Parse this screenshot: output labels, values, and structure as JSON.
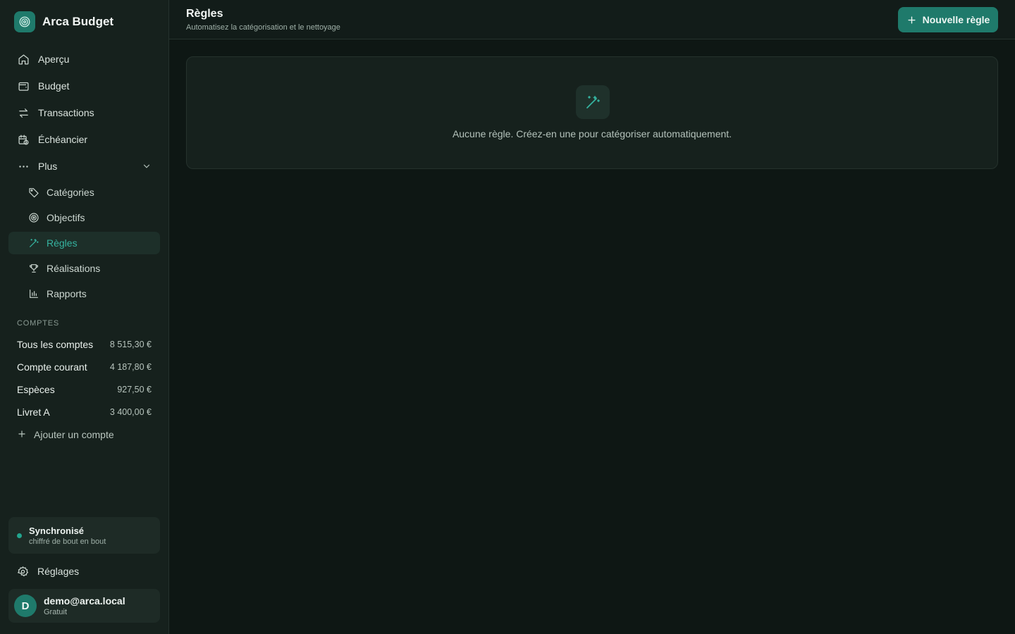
{
  "app": {
    "name": "Arca Budget",
    "logo_icon": "fingerprint-icon"
  },
  "nav": {
    "items": [
      {
        "label": "Aperçu",
        "icon": "home-icon"
      },
      {
        "label": "Budget",
        "icon": "wallet-icon"
      },
      {
        "label": "Transactions",
        "icon": "arrows-exchange-icon"
      },
      {
        "label": "Échéancier",
        "icon": "calendar-clock-icon"
      },
      {
        "label": "Plus",
        "icon": "more-dots-icon"
      }
    ],
    "sub_items": [
      {
        "label": "Catégories",
        "icon": "tag-icon"
      },
      {
        "label": "Objectifs",
        "icon": "target-icon"
      },
      {
        "label": "Règles",
        "icon": "magic-wand-icon",
        "active": true
      },
      {
        "label": "Réalisations",
        "icon": "trophy-icon"
      },
      {
        "label": "Rapports",
        "icon": "bar-chart-icon"
      }
    ]
  },
  "accounts": {
    "section_label": "COMPTES",
    "items": [
      {
        "name": "Tous les comptes",
        "amount": "8 515,30 €"
      },
      {
        "name": "Compte courant",
        "amount": "4 187,80 €"
      },
      {
        "name": "Espèces",
        "amount": "927,50 €"
      },
      {
        "name": "Livret A",
        "amount": "3 400,00 €"
      }
    ],
    "add_label": "Ajouter un compte"
  },
  "sync": {
    "title": "Synchronisé",
    "subtitle": "chiffré de bout en bout"
  },
  "settings_label": "Réglages",
  "user": {
    "initial": "D",
    "email": "demo@arca.local",
    "plan": "Gratuit"
  },
  "header": {
    "title": "Règles",
    "subtitle": "Automatisez la catégorisation et le nettoyage",
    "new_button": "Nouvelle règle"
  },
  "empty_state": {
    "text": "Aucune règle. Créez-en une pour catégoriser automatiquement."
  },
  "colors": {
    "accent": "#1f7a6b",
    "accent_text": "#35b3a0",
    "background": "#0e1714",
    "sidebar": "#16211d"
  }
}
